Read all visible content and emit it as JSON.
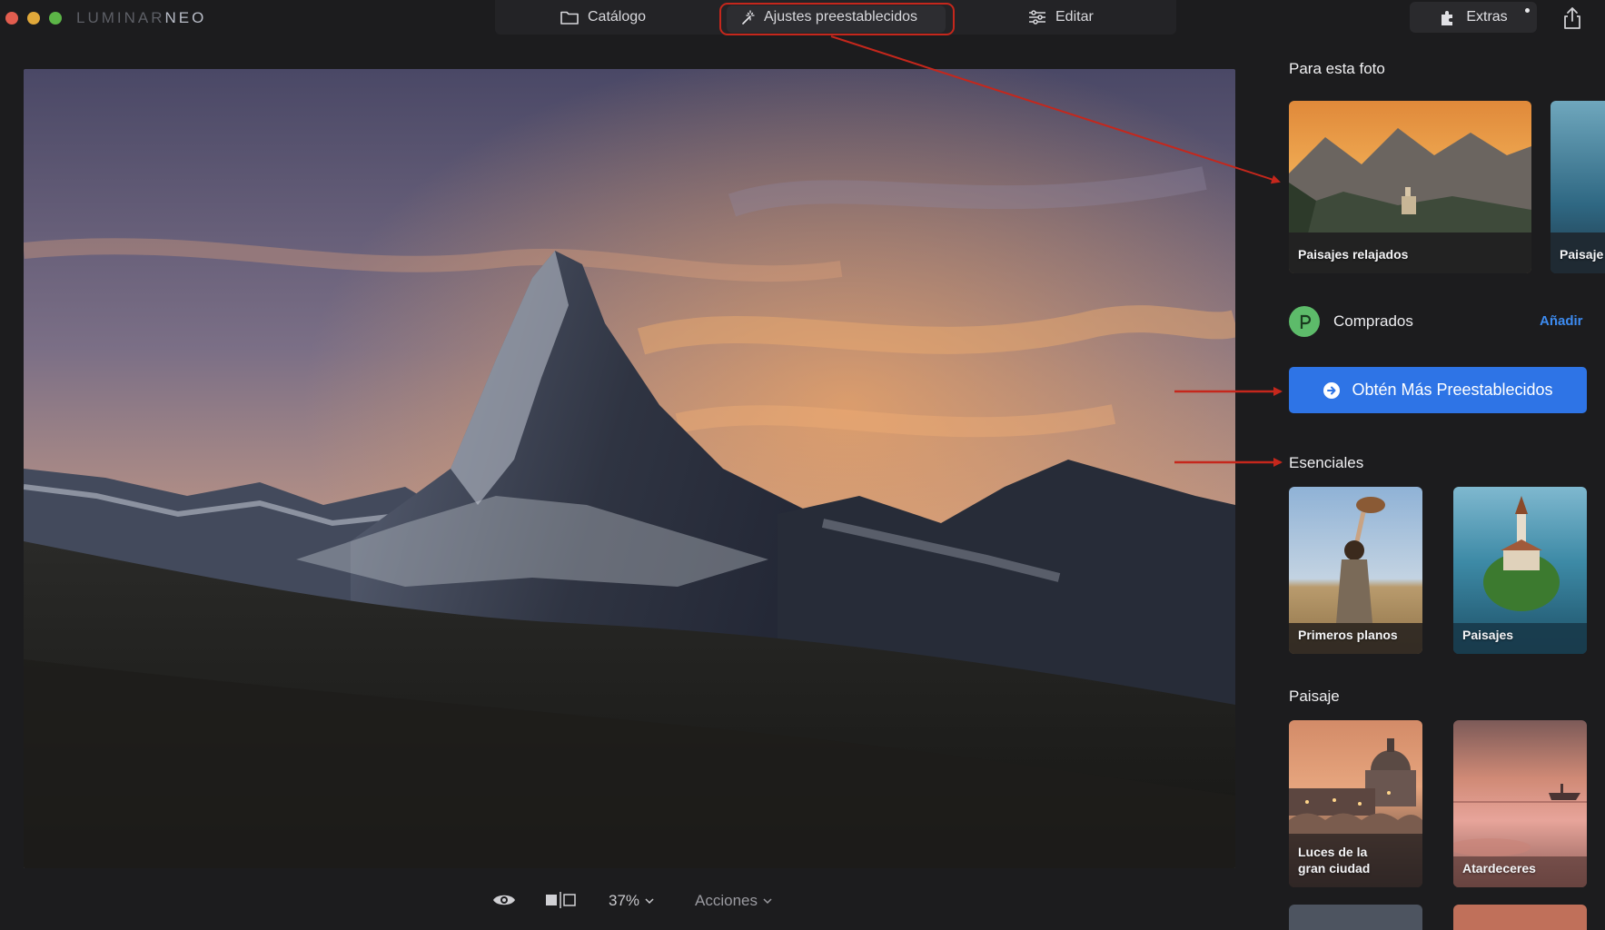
{
  "app": {
    "brand_part1": "LUMINAR",
    "brand_part2": "NEO"
  },
  "tabs": {
    "catalog": "Catálogo",
    "presets": "Ajustes preestablecidos",
    "edit": "Editar"
  },
  "topright": {
    "extras": "Extras"
  },
  "bottombar": {
    "zoom": "37%",
    "actions": "Acciones"
  },
  "panel": {
    "for_this_photo_title": "Para esta foto",
    "for_this_photo_cards": [
      "Paisajes relajados",
      "Paisaje"
    ],
    "purchased_label": "Comprados",
    "add_label": "Añadir",
    "get_more_label": "Obtén Más Preestablecidos",
    "essentials_title": "Esenciales",
    "essentials_cards": [
      "Primeros planos",
      "Paisajes"
    ],
    "landscape_title": "Paisaje",
    "landscape_cards": [
      "Luces de la gran ciudad",
      "Atardeceres"
    ]
  },
  "colors": {
    "accent_blue": "#2e74e6",
    "link_blue": "#3d8bf0",
    "annotation_red": "#c5271c",
    "purchased_green": "#5dbb6a"
  }
}
